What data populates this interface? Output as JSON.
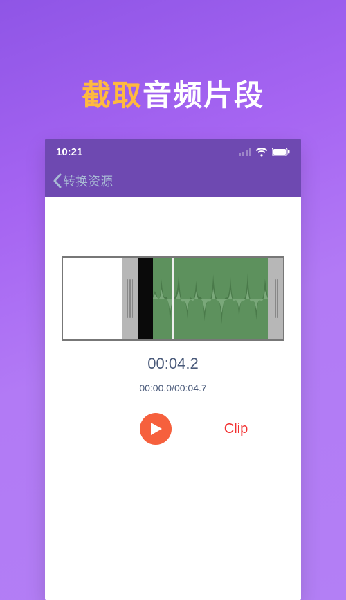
{
  "headline": {
    "accent": "截取",
    "rest": "音频片段"
  },
  "statusbar": {
    "time": "10:21"
  },
  "nav": {
    "back_label": "转换资源"
  },
  "player": {
    "current_time": "00:04.2",
    "range": "00:00.0/00:04.7"
  },
  "controls": {
    "clip_label": "Clip"
  }
}
